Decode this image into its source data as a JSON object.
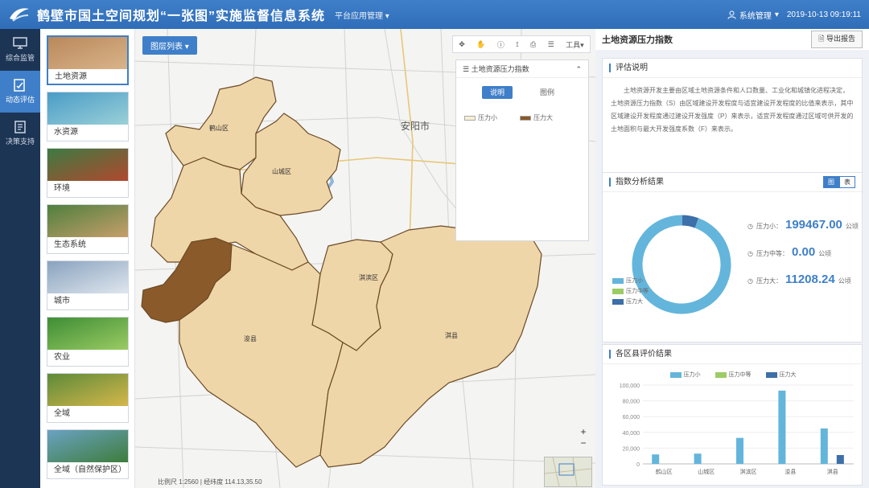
{
  "header": {
    "title": "鹤壁市国土空间规划“一张图”实施监督信息系统",
    "system_menu": "平台应用管理",
    "user": "系统管理",
    "datetime": "2019-10-13  09:19:11"
  },
  "nav": [
    {
      "label": "综合监管",
      "icon": "monitor-icon"
    },
    {
      "label": "动态评估",
      "icon": "evaluate-icon"
    },
    {
      "label": "决策支持",
      "icon": "document-icon"
    }
  ],
  "thumbnails": [
    {
      "label": "土地资源",
      "colors": [
        "#b9885a",
        "#d9b48a"
      ]
    },
    {
      "label": "水资源",
      "colors": [
        "#4a9cc7",
        "#9ad0d8"
      ]
    },
    {
      "label": "环境",
      "colors": [
        "#3d7a42",
        "#b2482e"
      ]
    },
    {
      "label": "生态系统",
      "colors": [
        "#4f7f3e",
        "#c69f6a"
      ]
    },
    {
      "label": "城市",
      "colors": [
        "#8aa3bf",
        "#dfe6ee"
      ]
    },
    {
      "label": "农业",
      "colors": [
        "#3e8d35",
        "#9acb63"
      ]
    },
    {
      "label": "全域",
      "colors": [
        "#5d8a3a",
        "#d6b74a"
      ]
    },
    {
      "label": "全域（自然保护区）",
      "colors": [
        "#6aa2c2",
        "#3e7d3c"
      ]
    }
  ],
  "map": {
    "layer_button": "图层列表",
    "toolbar_label": "工具",
    "legend_panel": {
      "title": "土地资源压力指数",
      "tabs": [
        "说明",
        "图例"
      ],
      "items": [
        {
          "label": "压力小",
          "color": "#f6efd2"
        },
        {
          "label": "压力大",
          "color": "#8a5a2a"
        }
      ]
    },
    "districts": [
      {
        "name": "鹤山区",
        "color": "#efd6a8"
      },
      {
        "name": "山城区",
        "color": "#efd6a8"
      },
      {
        "name": "淇滨区",
        "color": "#efd6a8"
      },
      {
        "name": "淇县",
        "color": "#efd6a8"
      },
      {
        "name": "浚县",
        "color": "#efd6a8"
      },
      {
        "name": "",
        "color": "#8a5a2a"
      }
    ],
    "places": [
      "安阳市"
    ],
    "coords": "比例尺 1:2560 | 经纬度 114.13,35.50",
    "zoom_in": "+",
    "zoom_out": "−"
  },
  "right": {
    "title": "土地资源压力指数",
    "export": "导出报告",
    "intro": {
      "title": "评估说明",
      "text": "土地资源开发主要由区域土地资源条件和人口数量、工业化和城镇化进程决定，土地资源压力指数（S）由区域建设开发程度与适宜建设开发程度的比值来表示，其中区域建设开发程度通过建设开发强度（P）来表示，适宜开发程度通过区域可供开发的土地面积与最大开发强度系数（F）来表示。"
    },
    "summary": {
      "title": "指数分析结果",
      "toggle": [
        "图",
        "表"
      ],
      "stats": [
        {
          "label": "压力小：",
          "value": "199467.00",
          "unit": "公顷",
          "color": "#64b5db"
        },
        {
          "label": "压力中等：",
          "value": "0.00",
          "unit": "公顷",
          "color": "#9ccc65"
        },
        {
          "label": "压力大：",
          "value": "11208.24",
          "unit": "公顷",
          "color": "#3d6fa8"
        }
      ]
    },
    "bar": {
      "title": "各区县评价结果"
    }
  },
  "chart_data": [
    {
      "type": "pie",
      "title": "",
      "labels": [
        "压力小",
        "压力中等",
        "压力大"
      ],
      "values": [
        199467.0,
        0.0,
        11208.24
      ],
      "colors": [
        "#64b5db",
        "#9ccc65",
        "#3d6fa8"
      ]
    },
    {
      "type": "bar",
      "title": "各区县评价结果",
      "categories": [
        "鹤山区",
        "山城区",
        "淇滨区",
        "浚县",
        "淇县"
      ],
      "series": [
        {
          "name": "压力小",
          "values": [
            12000,
            13000,
            33000,
            93000,
            45000
          ],
          "color": "#64b5db"
        },
        {
          "name": "压力中等",
          "values": [
            0,
            0,
            0,
            0,
            0
          ],
          "color": "#9ccc65"
        },
        {
          "name": "压力大",
          "values": [
            0,
            0,
            0,
            0,
            11208
          ],
          "color": "#3d6fa8"
        }
      ],
      "yticks": [
        "0",
        "20,000",
        "40,000",
        "60,000",
        "80,000",
        "100,000"
      ],
      "ylim": [
        0,
        100000
      ],
      "legend_position": "top"
    }
  ]
}
